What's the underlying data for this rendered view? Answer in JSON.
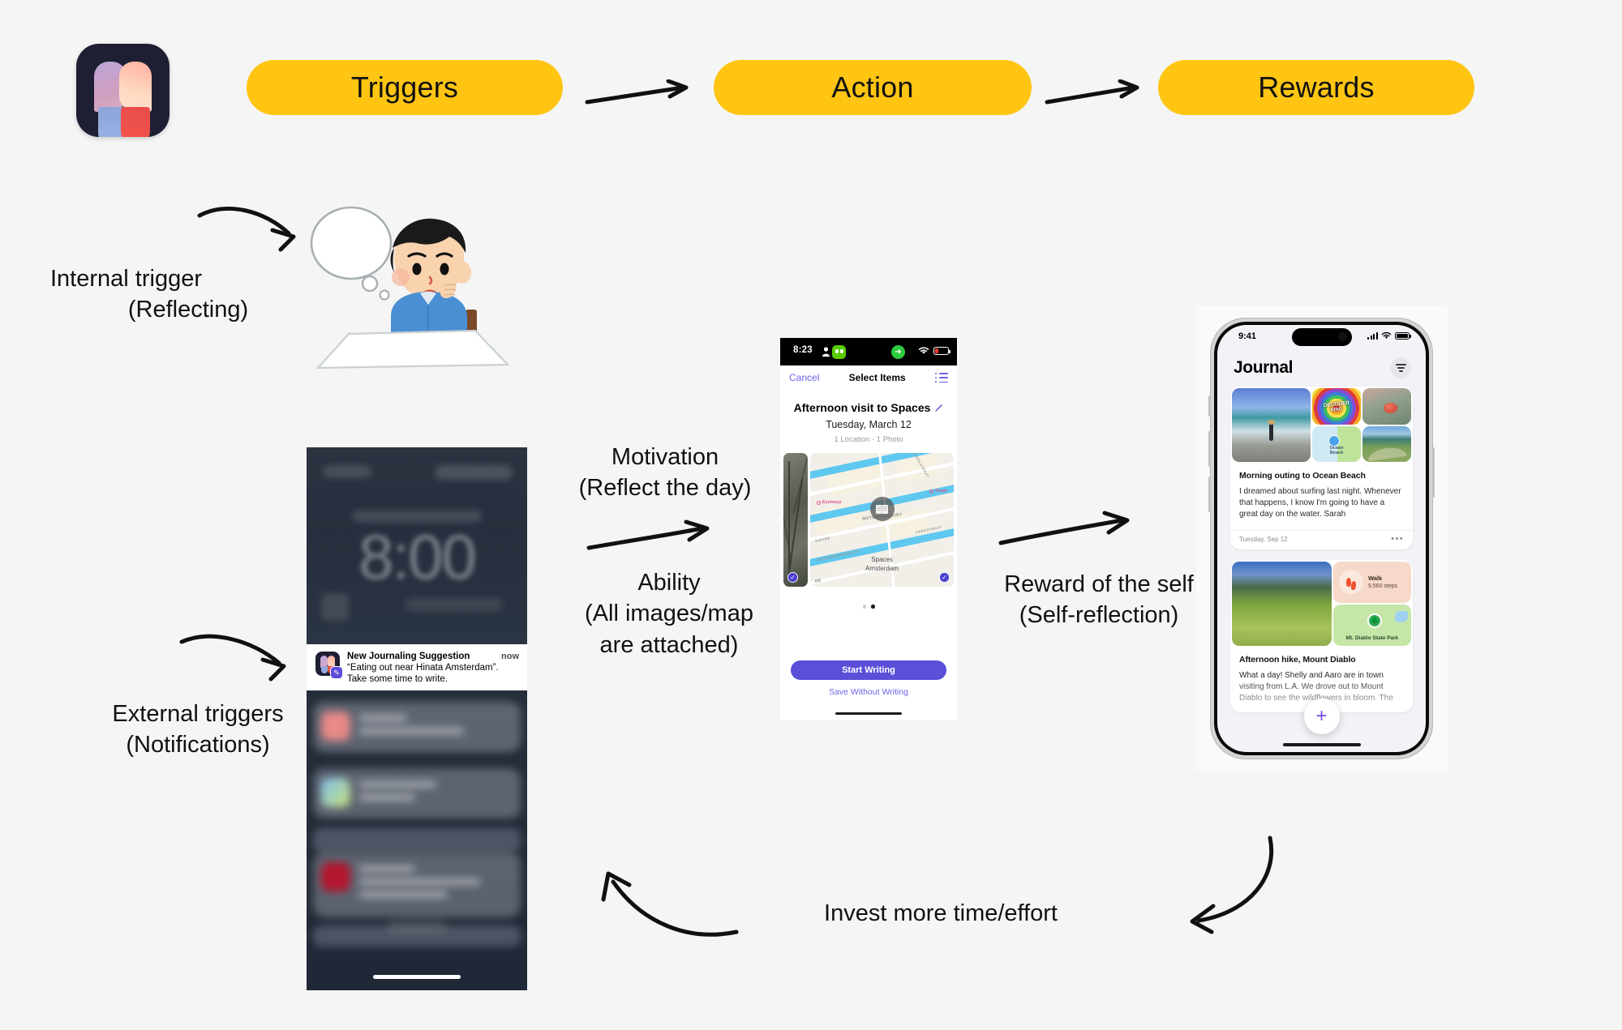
{
  "canvas": {
    "background": "#f5f5f5",
    "accent_yellow": "#FFC512",
    "accent_purple": "#5B4FD8"
  },
  "app_icon": {
    "name": "journaling-app-icon"
  },
  "flow": {
    "steps": [
      {
        "id": "triggers",
        "label": "Triggers"
      },
      {
        "id": "action",
        "label": "Action"
      },
      {
        "id": "rewards",
        "label": "Rewards"
      }
    ],
    "arrows": [
      "arrow-triggers-to-action",
      "arrow-action-to-rewards"
    ]
  },
  "annotations": {
    "internal_trigger": {
      "line1": "Internal trigger",
      "line2": "(Reflecting)"
    },
    "external_trigger": {
      "line1": "External triggers",
      "line2": "(Notifications)"
    },
    "motivation": {
      "line1": "Motivation",
      "line2": "(Reflect the day)"
    },
    "ability": {
      "line1": "Ability",
      "line2": "(All images/map",
      "line3": "are attached)"
    },
    "reward": {
      "line1": "Reward of the self",
      "line2": "(Self-reflection)"
    },
    "invest": {
      "line1": "Invest more time/effort"
    }
  },
  "lock_phone": {
    "name": "iphone-lock-screen",
    "clock": "8:00",
    "notification": {
      "app_icon": "journaling-suggestion-icon",
      "title": "New Journaling Suggestion",
      "time": "now",
      "body": "“Eating out near Hinata Amsterdam”. Take some time to write."
    },
    "blurred_notifications_count": 3
  },
  "select_items_phone": {
    "name": "select-items-screen",
    "status_bar": {
      "time": "8:23",
      "battery_state": "low",
      "wifi": true,
      "dynamic_island_app": "duolingo"
    },
    "nav": {
      "cancel": "Cancel",
      "title": "Select Items",
      "list_icon": "list-icon"
    },
    "entry": {
      "title": "Afternoon visit to Spaces",
      "date": "Tuesday, March 12",
      "meta": "1 Location · 1 Photo"
    },
    "map": {
      "place_line1": "Spaces",
      "place_line2": "Amsterdam",
      "pois": [
        "Foam",
        "Eyemazy"
      ],
      "streets": [
        "VIJZELSTRAAT",
        "KERKSTRAAT",
        "NIEUWE",
        "WETERINGDWARSSTR",
        "DE",
        "WETERINGBUURT"
      ],
      "district": "ERINGBUURT"
    },
    "carousel": {
      "dots": 2,
      "active_index": 1
    },
    "primary_button": "Start Writing",
    "secondary_button": "Save Without Writing"
  },
  "journal_phone": {
    "name": "journal-app-screen",
    "status_bar": {
      "time": "9:41",
      "signal": true,
      "wifi": true,
      "battery": "full"
    },
    "header": {
      "title": "Journal",
      "filter_icon": "filter-icon"
    },
    "entries": [
      {
        "title": "Morning outing to Ocean Beach",
        "text": "I dreamed about surfing last night. Whenever that happens, I know I'm going to have a great day on the water. Sarah",
        "date": "Tuesday, Sep 12",
        "menu": "•••",
        "media": {
          "main_photo": "surfer-on-beach",
          "tiles": [
            "decoder-ring-album-art",
            "sea-urchin-photo",
            "ocean-beach-map",
            "coastal-road-photo"
          ],
          "album_title_line1": "DECODER",
          "album_title_line2": "RING",
          "map_label_line1": "Ocean",
          "map_label_line2": "Beach"
        }
      },
      {
        "title": "Afternoon hike, Mount Diablo",
        "text": "What a day! Shelly and Aaro are in town visiting from L.A. We drove out to Mount Diablo to see the wildflowers in bloom. The",
        "media": {
          "main_photo": "mount-diablo-meadow",
          "walk_title": "Walk",
          "walk_value": "9,560 steps",
          "park_label": "Mt. Diablo State Park"
        }
      }
    ],
    "compose_button": "+"
  }
}
